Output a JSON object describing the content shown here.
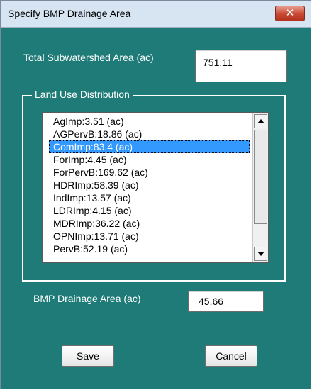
{
  "window": {
    "title": "Specify BMP Drainage Area",
    "close_glyph": "✕"
  },
  "total_area": {
    "label": "Total Subwatershed Area (ac)",
    "value": "751.11"
  },
  "land_use": {
    "group_label": "Land Use Distribution",
    "items": [
      "AgImp:3.51 (ac)",
      "AGPervB:18.86 (ac)",
      "ComImp:83.4 (ac)",
      "ForImp:4.45 (ac)",
      "ForPervB:169.62 (ac)",
      "HDRImp:58.39 (ac)",
      "IndImp:13.57 (ac)",
      "LDRImp:4.15 (ac)",
      "MDRImp:36.22 (ac)",
      "OPNImp:13.71 (ac)",
      "PervB:52.19 (ac)"
    ],
    "selected_index": 2
  },
  "bmp_area": {
    "label": "BMP Drainage Area (ac)",
    "value": "45.66"
  },
  "buttons": {
    "save": "Save",
    "cancel": "Cancel"
  },
  "icons": {
    "close": "close-icon",
    "scroll_up": "arrow-up-icon",
    "scroll_down": "arrow-down-icon"
  },
  "colors": {
    "dialog_background": "#1e7b78",
    "titlebar": "#d7e4f2",
    "selection": "#3399ff",
    "close_button": "#c84733"
  }
}
